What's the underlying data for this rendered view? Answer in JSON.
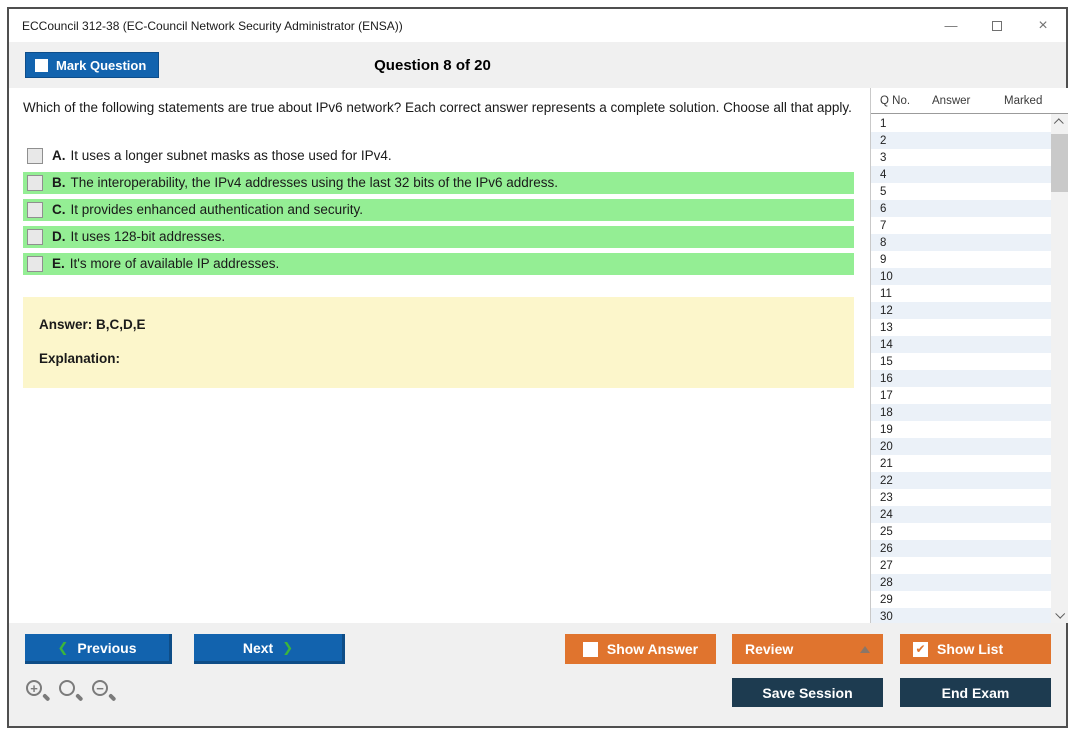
{
  "window": {
    "title": "ECCouncil 312-38 (EC-Council Network Security Administrator (ENSA))",
    "controls": {
      "minimize": "—",
      "close": "×"
    }
  },
  "header": {
    "mark_question_label": "Mark Question",
    "question_counter": "Question 8 of 20"
  },
  "question": {
    "text": "Which of the following statements are true about IPv6 network? Each correct answer represents a complete solution. Choose all that apply.",
    "options": [
      {
        "letter": "A.",
        "text": "It uses a longer subnet masks as those used for IPv4.",
        "highlighted": false,
        "checked": false
      },
      {
        "letter": "B.",
        "text": "The interoperability, the IPv4 addresses using the last 32 bits of the IPv6 address.",
        "highlighted": true,
        "checked": false
      },
      {
        "letter": "C.",
        "text": "It provides enhanced authentication and security.",
        "highlighted": true,
        "checked": false
      },
      {
        "letter": "D.",
        "text": "It uses 128-bit addresses.",
        "highlighted": true,
        "checked": false
      },
      {
        "letter": "E.",
        "text": "It's more of available IP addresses.",
        "highlighted": true,
        "checked": false
      }
    ],
    "answer_label": "Answer: B,C,D,E",
    "explanation_label": "Explanation:"
  },
  "question_list": {
    "columns": {
      "qno": "Q No.",
      "answer": "Answer",
      "marked": "Marked"
    },
    "rows": [
      "1",
      "2",
      "3",
      "4",
      "5",
      "6",
      "7",
      "8",
      "9",
      "10",
      "11",
      "12",
      "13",
      "14",
      "15",
      "16",
      "17",
      "18",
      "19",
      "20",
      "21",
      "22",
      "23",
      "24",
      "25",
      "26",
      "27",
      "28",
      "29",
      "30"
    ]
  },
  "footer": {
    "previous_label": "Previous",
    "next_label": "Next",
    "prev_icon": "❮",
    "next_icon": "❯",
    "show_answer_label": "Show Answer",
    "review_label": "Review",
    "show_list_label": "Show List",
    "show_list_check": "✔",
    "save_session_label": "Save Session",
    "end_exam_label": "End Exam",
    "zoom_in_glyph": "+",
    "zoom_out_glyph": "−"
  },
  "colors": {
    "accent_blue": "#1263ae",
    "accent_orange": "#e0742e",
    "accent_navy": "#1d3b50",
    "highlight_green": "#94ee94",
    "answer_yellow": "#fcf6cb",
    "row_stripe": "#ebf1f8",
    "band_gray": "#f0f0f0"
  }
}
